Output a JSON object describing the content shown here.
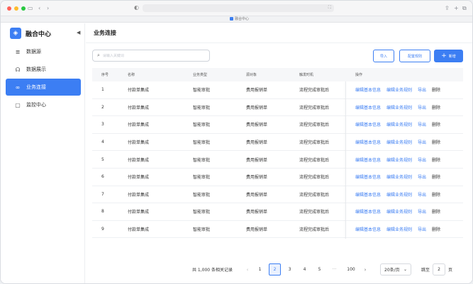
{
  "browser": {
    "tab_title": "融合中心"
  },
  "sidebar": {
    "brand": "融合中心",
    "items": [
      {
        "label": "数据源",
        "icon": "database-icon",
        "active": false
      },
      {
        "label": "数据展示",
        "icon": "display-icon",
        "active": false
      },
      {
        "label": "业务连接",
        "icon": "link-icon",
        "active": true
      },
      {
        "label": "监控中心",
        "icon": "monitor-icon",
        "active": false
      }
    ]
  },
  "main": {
    "title": "业务连接",
    "search_placeholder": "请输入关键词",
    "buttons": {
      "import": "导入",
      "rules": "配置规则",
      "add": "新增"
    },
    "columns": [
      "序号",
      "名称",
      "业务类型",
      "源对象",
      "触发时机",
      "操作"
    ],
    "rows": [
      {
        "idx": "1",
        "name": "付款单集成",
        "biz": "智能审批",
        "src": "费用报销单",
        "trigger": "流程完成审批后"
      },
      {
        "idx": "2",
        "name": "付款单集成",
        "biz": "智能审批",
        "src": "费用报销单",
        "trigger": "流程完成审批后"
      },
      {
        "idx": "3",
        "name": "付款单集成",
        "biz": "智能审批",
        "src": "费用报销单",
        "trigger": "流程完成审批后"
      },
      {
        "idx": "4",
        "name": "付款单集成",
        "biz": "智能审批",
        "src": "费用报销单",
        "trigger": "流程完成审批后"
      },
      {
        "idx": "5",
        "name": "付款单集成",
        "biz": "智能审批",
        "src": "费用报销单",
        "trigger": "流程完成审批后"
      },
      {
        "idx": "6",
        "name": "付款单集成",
        "biz": "智能审批",
        "src": "费用报销单",
        "trigger": "流程完成审批后"
      },
      {
        "idx": "7",
        "name": "付款单集成",
        "biz": "智能审批",
        "src": "费用报销单",
        "trigger": "流程完成审批后"
      },
      {
        "idx": "8",
        "name": "付款单集成",
        "biz": "智能审批",
        "src": "费用报销单",
        "trigger": "流程完成审批后"
      },
      {
        "idx": "9",
        "name": "付款单集成",
        "biz": "智能审批",
        "src": "费用报销单",
        "trigger": "流程完成审批后"
      }
    ],
    "row_actions": [
      "编辑基本信息",
      "编辑业务规则",
      "导出",
      "删除"
    ]
  },
  "pagination": {
    "total_text": "共 1,000 条相关记录",
    "pages": [
      "1",
      "2",
      "3",
      "4",
      "5"
    ],
    "current_page": "2",
    "ellipsis": "···",
    "last_page": "100",
    "page_size": "20条/页",
    "jump_label": "跳至",
    "jump_value": "2",
    "jump_suffix": "页"
  },
  "colors": {
    "accent": "#3c7ef3"
  }
}
